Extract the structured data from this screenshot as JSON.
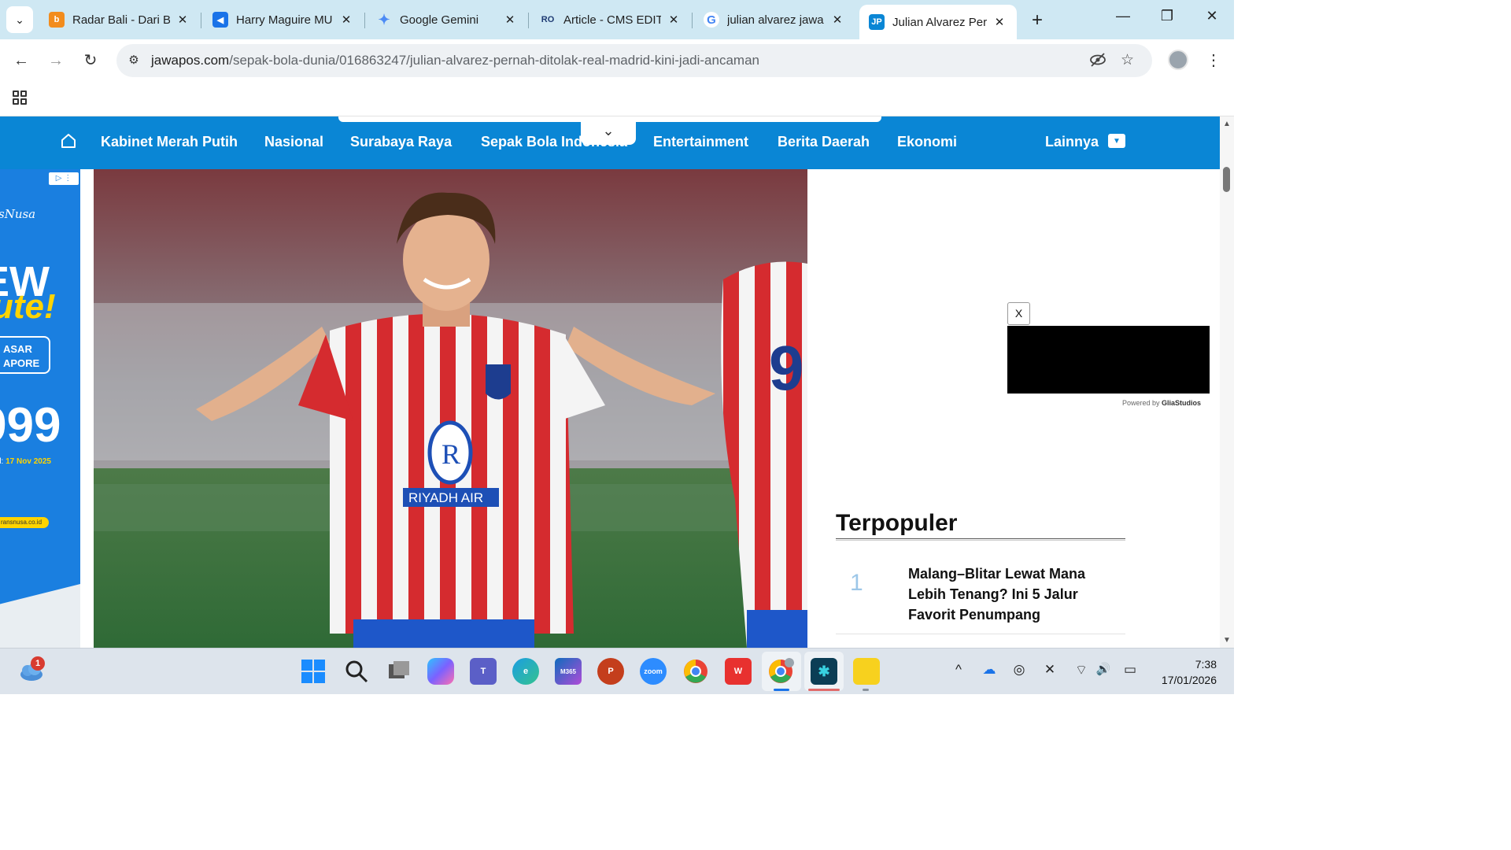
{
  "browser": {
    "tabs": [
      {
        "title": "Radar Bali - Dari Ba",
        "active": false,
        "favicon_color": "#f28c1d",
        "favicon_text": "b"
      },
      {
        "title": "Harry Maguire MU",
        "active": false,
        "favicon_color": "#1a73e8",
        "favicon_text": "◀"
      },
      {
        "title": "Google Gemini",
        "active": false,
        "favicon_color": "#4c8bf5",
        "favicon_text": "✦"
      },
      {
        "title": "Article - CMS EDITO",
        "active": false,
        "favicon_color": "#1f3b73",
        "favicon_text": "RO"
      },
      {
        "title": "julian alvarez jawa",
        "active": false,
        "favicon_color": "#ffffff",
        "favicon_text": "G"
      },
      {
        "title": "Julian Alvarez Pern",
        "active": true,
        "favicon_color": "#0a86d5",
        "favicon_text": "JP"
      }
    ],
    "new_tab_label": "+",
    "window_controls": {
      "minimize": "—",
      "restore": "❐",
      "close": "✕"
    },
    "address": {
      "host": "jawapos.com",
      "path": "/sepak-bola-dunia/016863247/julian-alvarez-pernah-ditolak-real-madrid-kini-jadi-ancaman"
    },
    "nav": {
      "back": "←",
      "forward": "→",
      "reload": "↻"
    }
  },
  "site": {
    "nav_links": [
      "Kabinet Merah Putih",
      "Nasional",
      "Surabaya Raya",
      "Sepak Bola Indonesia",
      "Entertainment",
      "Berita Daerah",
      "Ekonomi"
    ],
    "more_label": "Lainnya",
    "dropdown_glyph": "⌄"
  },
  "left_ad": {
    "brand": "sNusa",
    "big_line1": "EW",
    "big_line2": "ute!",
    "pill_line1": "ASAR",
    "pill_line2": "APORE",
    "price": "999",
    "period_prefix": "d:",
    "period_date": "17 Nov 2025",
    "site": "ransnusa.co.id",
    "badge": "▷ ⋮"
  },
  "hero": {
    "sponsor": "RIYADH AIR",
    "player_number": "9"
  },
  "video_ad": {
    "close_label": "X",
    "powered_prefix": "Powered by",
    "powered_brand": "GliaStudios"
  },
  "popular": {
    "title": "Terpopuler",
    "items": [
      {
        "rank": "1",
        "headline": "Malang–Blitar Lewat Mana Lebih Tenang? Ini 5 Jalur Favorit Penumpang"
      }
    ]
  },
  "taskbar": {
    "weather_badge": "1",
    "apps": [
      {
        "name": "windows-start",
        "color": "#1a8cff",
        "label": ""
      },
      {
        "name": "search",
        "color": "transparent",
        "label": ""
      },
      {
        "name": "task-view",
        "color": "#6b7280",
        "label": ""
      },
      {
        "name": "copilot",
        "color": "#7b61ff",
        "label": ""
      },
      {
        "name": "teams",
        "color": "#5b5fc7",
        "label": "T"
      },
      {
        "name": "edge",
        "color": "#1b9de2",
        "label": "e"
      },
      {
        "name": "m365",
        "color": "#0f6cbd",
        "label": "M365"
      },
      {
        "name": "powerpoint",
        "color": "#c43e1c",
        "label": "P"
      },
      {
        "name": "zoom",
        "color": "#2d8cff",
        "label": "zoom"
      },
      {
        "name": "chrome",
        "color": "#ea4335",
        "label": ""
      },
      {
        "name": "wps",
        "color": "#e8312f",
        "label": "W"
      },
      {
        "name": "chrome-profile",
        "color": "#34a853",
        "label": ""
      },
      {
        "name": "snipping-app",
        "color": "#0b6e8c",
        "label": ""
      },
      {
        "name": "sticky-notes",
        "color": "#f7d11e",
        "label": ""
      }
    ],
    "tray": [
      "^",
      "☁",
      "◎",
      "✕",
      "⌔",
      "🔊",
      "▭"
    ],
    "time": "7:38",
    "date": "17/01/2026"
  }
}
